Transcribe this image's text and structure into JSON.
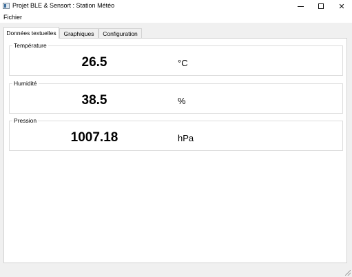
{
  "window": {
    "title": "Projet BLE & Sensort : Station Météo",
    "controls": {
      "minimize_icon": "minimize-icon",
      "maximize_icon": "maximize-icon",
      "close_glyph": "✕"
    }
  },
  "menubar": {
    "items": [
      {
        "label": "Fichier"
      }
    ]
  },
  "tabs": [
    {
      "label": "Données textuelles",
      "active": true
    },
    {
      "label": "Graphiques",
      "active": false
    },
    {
      "label": "Configuration",
      "active": false
    }
  ],
  "groups": [
    {
      "title": "Température",
      "value": "26.5",
      "unit": "°C"
    },
    {
      "title": "Humidité",
      "value": "38.5",
      "unit": "%"
    },
    {
      "title": "Pression",
      "value": "1007.18",
      "unit": "hPa"
    }
  ]
}
